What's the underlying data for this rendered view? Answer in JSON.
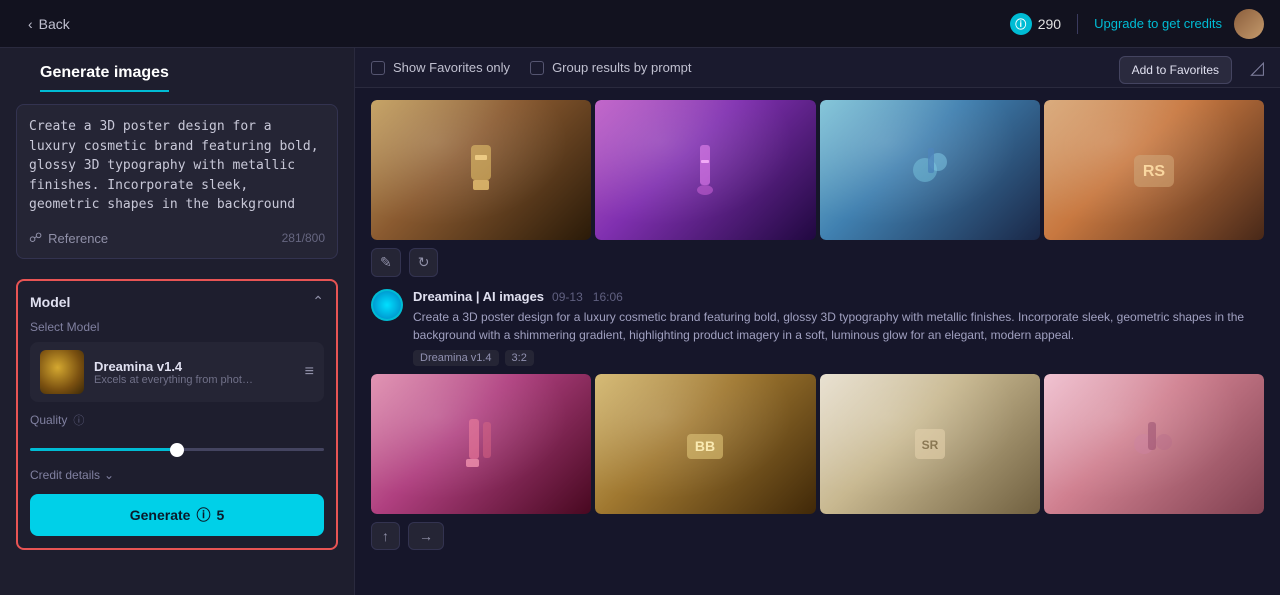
{
  "topbar": {
    "back_label": "Back",
    "credits_count": "290",
    "upgrade_label": "Upgrade to get credits"
  },
  "sidebar": {
    "title": "Generate images",
    "prompt_text": "Create a 3D poster design for a luxury cosmetic brand featuring bold, glossy 3D typography with metallic finishes. Incorporate sleek, geometric shapes in the background with a shimmering gradient, highlighting product imagery in a soft,",
    "reference_label": "Reference",
    "char_count": "281/800",
    "model_section": {
      "title": "Model",
      "select_label": "Select Model",
      "model_name": "Dreamina v1.4",
      "model_desc": "Excels at everything from photoreali...",
      "quality_label": "Quality",
      "quality_value": 50,
      "credit_details_label": "Credit details",
      "generate_label": "Generate",
      "generate_credits": "5"
    }
  },
  "toolbar": {
    "show_favorites_label": "Show Favorites only",
    "group_results_label": "Group results by prompt",
    "add_favorites_label": "Add to Favorites"
  },
  "content": {
    "gen_author": "Dreamina | AI images",
    "gen_date": "09-13",
    "gen_time": "16:06",
    "gen_prompt": "Create a 3D poster design for a luxury cosmetic brand featuring bold, glossy 3D typography with metallic finishes. Incorporate sleek, geometric shapes in the background with a shimmering gradient, highlighting product imagery in a soft, luminous glow for an elegant, modern appeal.",
    "gen_tag1": "Dreamina v1.4",
    "gen_tag2": "3:2"
  }
}
